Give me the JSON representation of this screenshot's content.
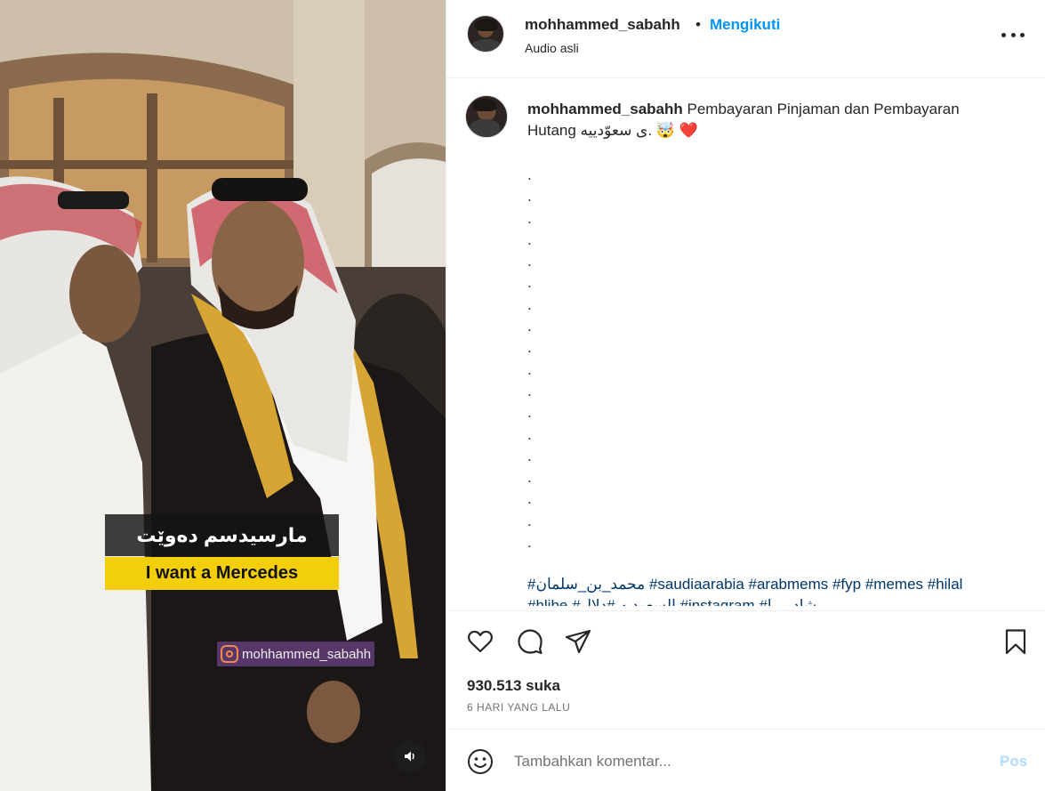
{
  "video": {
    "caption_kurdish": "مارسیدسم دەوێت",
    "caption_english": "I want a Mercedes",
    "watermark": "mohhammed_sabahh",
    "mute_icon": "speaker-icon"
  },
  "header": {
    "username": "mohhammed_sabahh",
    "separator": "•",
    "follow_label": "Mengikuti",
    "audio": "Audio asli",
    "more_icon": "more-horizontal-icon"
  },
  "caption": {
    "username": "mohhammed_sabahh",
    "text": "Pembayaran Pinjaman dan Pembayaran Hutang ی سعوّدییه. 🤯 ❤️",
    "dots": [
      ".",
      ".",
      ".",
      ".",
      ".",
      ".",
      ".",
      ".",
      ".",
      ".",
      ".",
      ".",
      ".",
      ".",
      ".",
      ".",
      ".",
      "."
    ],
    "hashtags_line1": "#محمد_بن_سلمان #saudiaarabia #arabmems #fyp #memes #hilal",
    "hashtags_line2": "#hlibe #السعوديه #دلال #instagram #شادميرا"
  },
  "actions": {
    "like_icon": "heart-icon",
    "comment_icon": "comment-icon",
    "share_icon": "send-icon",
    "save_icon": "bookmark-icon",
    "likes_text": "930.513 suka",
    "time_text": "6 HARI YANG LALU"
  },
  "comment_box": {
    "emoji_icon": "emoji-icon",
    "placeholder": "Tambahkan komentar...",
    "post_label": "Pos"
  },
  "colors": {
    "accent": "#0095f6",
    "hashtag": "#00376b",
    "caption_bar": "#f3cf0b",
    "post_disabled": "#b3dbff"
  }
}
